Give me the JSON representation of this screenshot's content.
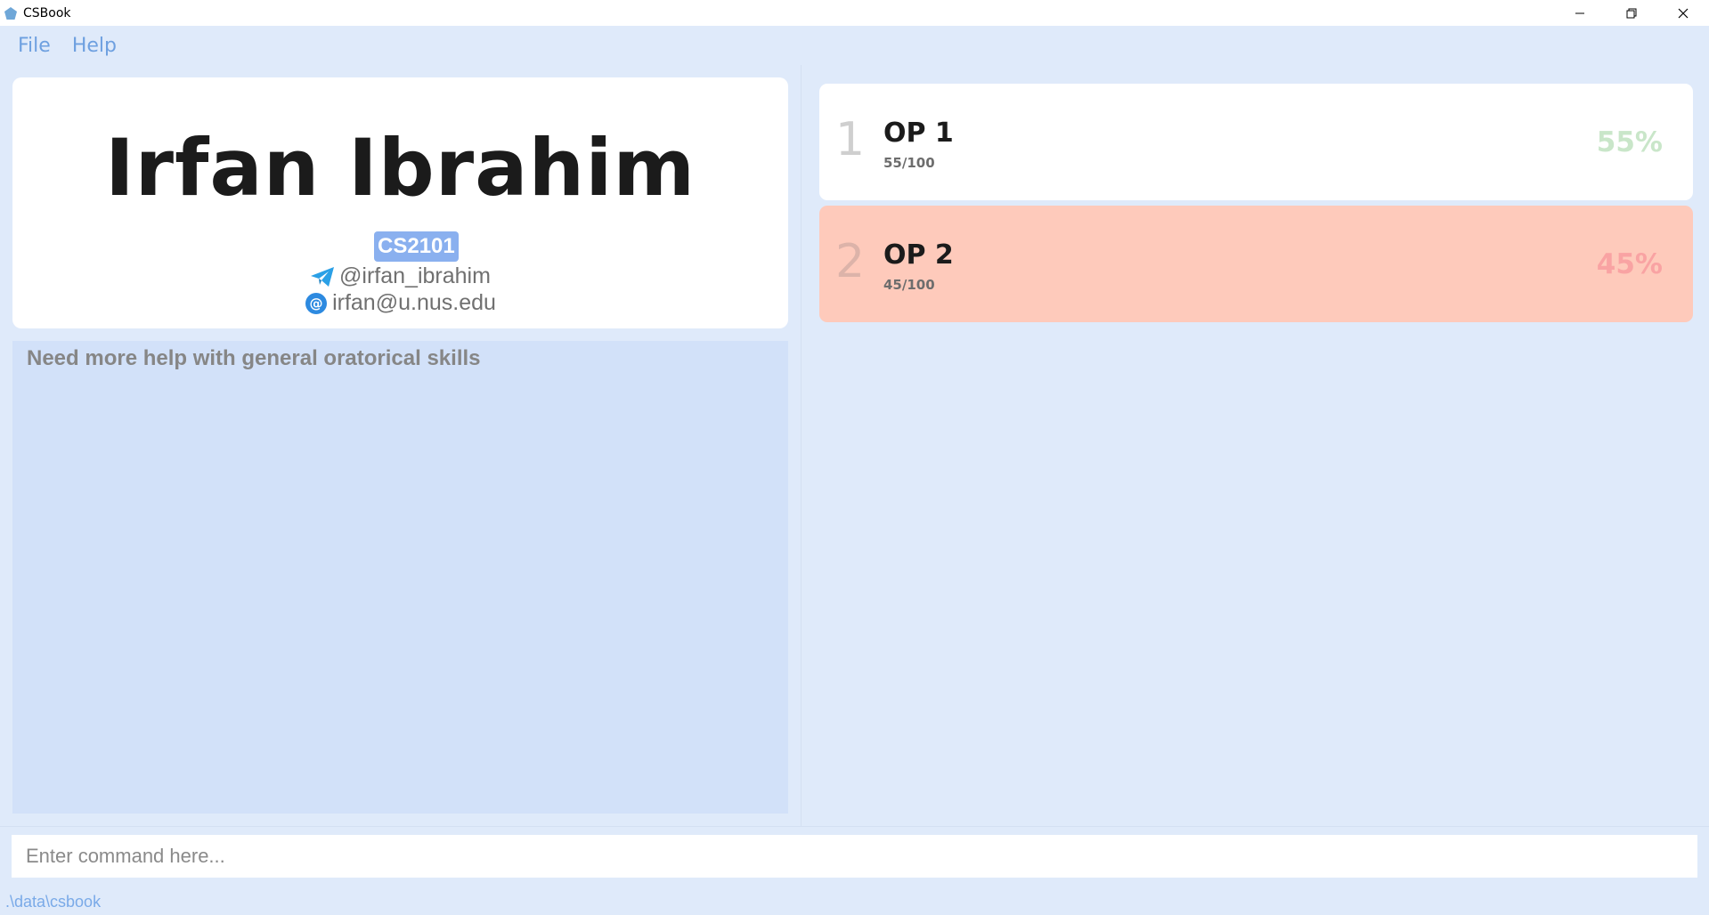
{
  "window": {
    "title": "CSBook",
    "app_icon": "pentagon-icon",
    "controls": [
      "minimize-icon",
      "restore-icon",
      "close-icon"
    ]
  },
  "menu": {
    "items": [
      "File",
      "Help"
    ]
  },
  "profile": {
    "name": "Irfan Ibrahim",
    "tag": "CS2101",
    "telegram": "@irfan_ibrahim",
    "email": "irfan@u.nus.edu"
  },
  "notes": {
    "text": "Need more help with general oratorical skills"
  },
  "assessments": [
    {
      "index": "1",
      "title": "OP 1",
      "score": "55/100",
      "percent": "55%"
    },
    {
      "index": "2",
      "title": "OP 2",
      "score": "45/100",
      "percent": "45%"
    }
  ],
  "command": {
    "placeholder": "Enter command here..."
  },
  "status": {
    "path": ".\\data\\csbook"
  },
  "colors": {
    "background": "#dfeafa",
    "accent": "#6ea0e0",
    "tag": "#8ab0ef",
    "failing_card": "#fecabb",
    "pass_percent": "#c9e6c9",
    "fail_percent": "#f9a3a3"
  }
}
